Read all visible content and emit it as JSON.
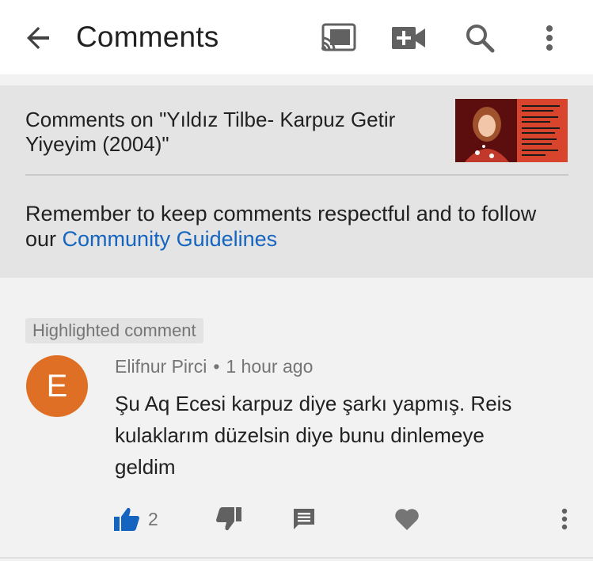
{
  "header": {
    "title": "Comments",
    "icons": [
      "back-arrow-icon",
      "cast-icon",
      "video-camera-add-icon",
      "search-icon",
      "more-vertical-icon"
    ]
  },
  "video": {
    "title": "Comments on \"Yıldız Tilbe- Karpuz Getir Yiyeyim (2004)\""
  },
  "guidelines": {
    "text": "Remember to keep comments respectful and to follow our",
    "link": "Community Guidelines"
  },
  "comment": {
    "badge": "Highlighted comment",
    "avatar_letter": "E",
    "avatar_color": "#e06f26",
    "author": "Elifnur Pirci",
    "separator": "•",
    "time": "1 hour ago",
    "text": "Şu Aq Ecesi karpuz diye şarkı yapmış. Reis kulaklarım düzelsin diye bunu dinlemeye geldim",
    "likes": "2"
  },
  "colors": {
    "accent_link": "#1565c0",
    "like_active": "#1565c0",
    "icon_gray": "#757575"
  }
}
